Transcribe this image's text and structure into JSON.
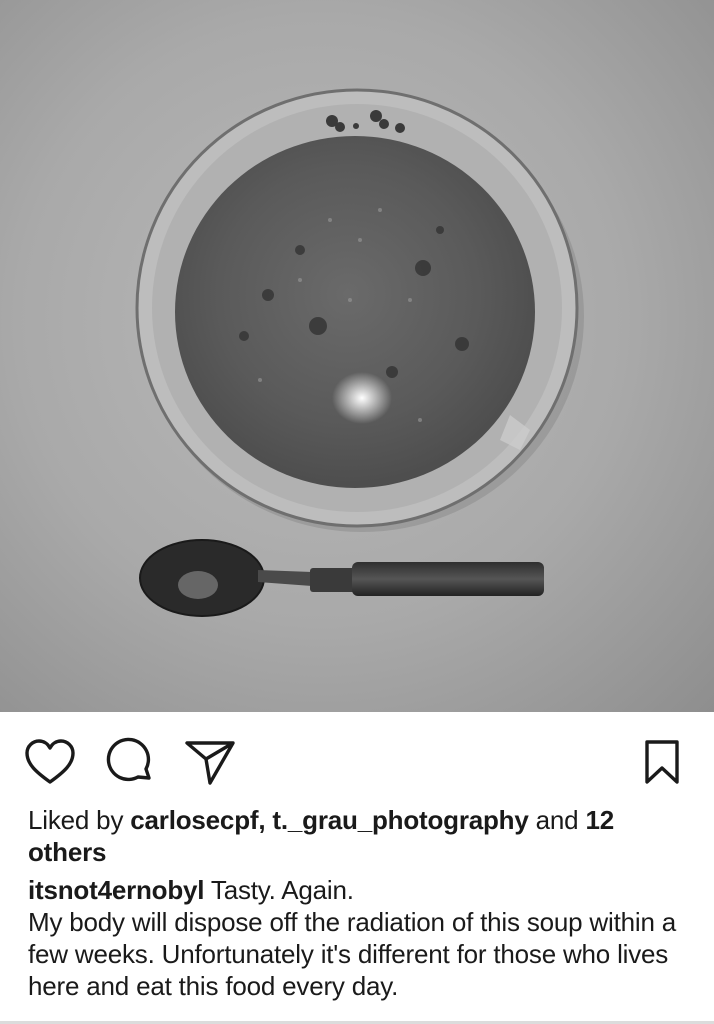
{
  "post": {
    "image_alt": "Bowl of soup with a spoon on a table",
    "actions": {
      "like_icon": "heart-icon",
      "comment_icon": "comment-icon",
      "share_icon": "send-icon",
      "save_icon": "bookmark-icon"
    },
    "likes": {
      "prefix": "Liked by ",
      "user1": "carlosecpf",
      "separator": ", ",
      "user2": "t._grau_photography",
      "and_text": " and ",
      "others": "12 others"
    },
    "caption": {
      "username": "itsnot4ernobyl",
      "first_line": " Tasty. Again.",
      "body": "My body will dispose off the radiation of this soup within a few weeks. Unfortunately it's different for those who lives here and eat this food every day."
    }
  },
  "colors": {
    "text": "#1a1a1a",
    "background": "#ffffff",
    "icon": "#1a1a1a"
  }
}
